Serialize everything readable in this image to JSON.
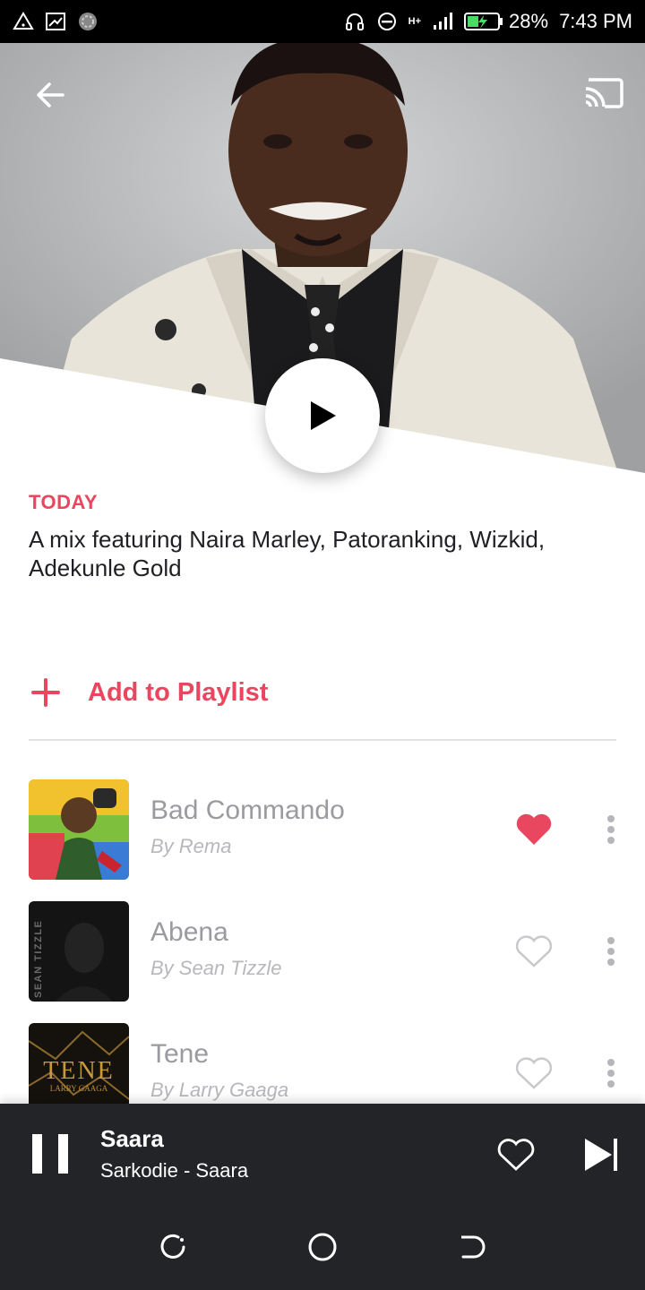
{
  "status_bar": {
    "battery": "28%",
    "time": "7:43 PM",
    "network_label": "H+"
  },
  "hero": {
    "back_icon": "arrow-left-icon",
    "cast_icon": "cast-icon",
    "play_icon": "play-icon"
  },
  "mix": {
    "label": "TODAY",
    "description": "A mix featuring Naira Marley, Patoranking, Wizkid, Adekunle Gold"
  },
  "actions": {
    "add_to_playlist": "Add to Playlist"
  },
  "tracks": [
    {
      "title": "Bad Commando",
      "artist": "By Rema",
      "liked": true,
      "art_text": ""
    },
    {
      "title": "Abena",
      "artist": "By Sean Tizzle",
      "liked": false,
      "art_text": "SEAN TIZZLE"
    },
    {
      "title": "Tene",
      "artist": "By Larry Gaaga",
      "liked": false,
      "art_text": "TENE",
      "art_sub": "LARRY GAAGA"
    }
  ],
  "now_playing": {
    "title": "Saara",
    "subtitle": "Sarkodie - Saara"
  },
  "colors": {
    "accent": "#e8475f",
    "player_bg": "#232428",
    "muted_text": "#9a9aa0"
  }
}
